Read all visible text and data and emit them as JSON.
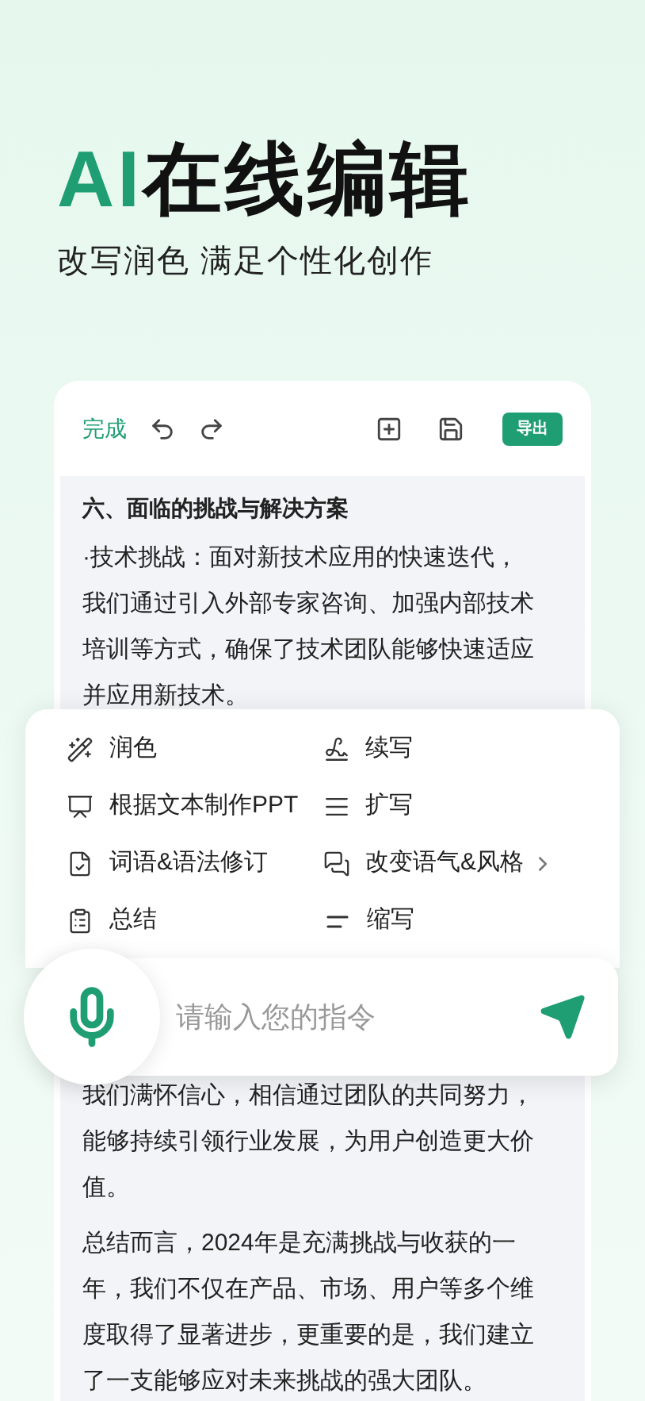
{
  "hero": {
    "title_accent": "AI",
    "title": "在线编辑",
    "subtitle": "改写润色 满足个性化创作"
  },
  "toolbar": {
    "done": "完成",
    "export": "导出"
  },
  "document_top": {
    "heading": "六、面临的挑战与解决方案",
    "paragraph": "·技术挑战：面对新技术应用的快速迭代，我们通过引入外部专家咨询、加强内部技术培训等方式，确保了技术团队能够快速适应并应用新技术。"
  },
  "ai_menu": [
    {
      "label": "润色",
      "has_submenu": false
    },
    {
      "label": "续写",
      "has_submenu": false
    },
    {
      "label": "根据文本制作PPT",
      "has_submenu": false
    },
    {
      "label": "扩写",
      "has_submenu": false
    },
    {
      "label": "词语&语法修订",
      "has_submenu": false
    },
    {
      "label": "改变语气&风格",
      "has_submenu": true
    },
    {
      "label": "总结",
      "has_submenu": false
    },
    {
      "label": "缩写",
      "has_submenu": false
    }
  ],
  "command_input": {
    "placeholder": "请输入您的指令"
  },
  "document_bottom": {
    "paragraphs": [
      "我们满怀信心，相信通过团队的共同努力，能够持续引领行业发展，为用户创造更大价值。",
      "总结而言，2024年是充满挑战与收获的一年，我们不仅在产品、市场、用户等多个维度取得了显著进步，更重要的是，我们建立了一支能够应对未来挑战的强大团队。"
    ]
  }
}
